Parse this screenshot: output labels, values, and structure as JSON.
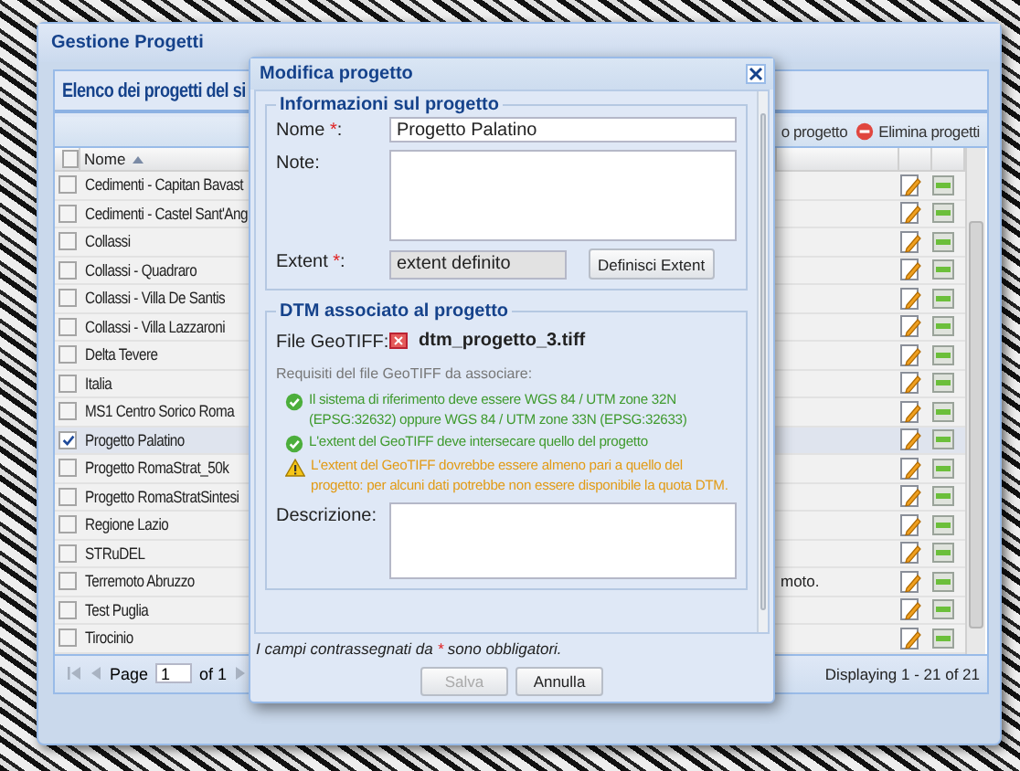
{
  "main_window": {
    "title": "Gestione Progetti",
    "panel_title": "Elenco dei progetti del si",
    "toolbar": [
      {
        "kind": "text",
        "label": "o progetto"
      },
      {
        "kind": "delete",
        "label": "Elimina progetti"
      }
    ],
    "grid": {
      "all_selected": false,
      "columns": [
        {
          "label": "Nome",
          "sort_ascending": true
        }
      ],
      "rows": [
        {
          "name": "Cedimenti - Capitan Bavast",
          "selected": false
        },
        {
          "name": "Cedimenti - Castel Sant'Ang",
          "selected": false
        },
        {
          "name": "Collassi",
          "selected": false
        },
        {
          "name": "Collassi - Quadraro",
          "selected": false
        },
        {
          "name": "Collassi - Villa De Santis",
          "selected": false
        },
        {
          "name": "Collassi - Villa Lazzaroni",
          "selected": false
        },
        {
          "name": "Delta Tevere",
          "selected": false
        },
        {
          "name": "Italia",
          "selected": false
        },
        {
          "name": "MS1 Centro Sorico Roma",
          "selected": false
        },
        {
          "name": "Progetto Palatino",
          "selected": true
        },
        {
          "name": "Progetto RomaStrat_50k",
          "selected": false
        },
        {
          "name": "Progetto RomaStratSintesi",
          "selected": false
        },
        {
          "name": "Regione Lazio",
          "selected": false
        },
        {
          "name": "STRuDEL",
          "selected": false
        },
        {
          "name": "Terremoto Abruzzo",
          "selected": false,
          "column_3": "moto."
        },
        {
          "name": "Test Puglia",
          "selected": false
        },
        {
          "name": "Tirocinio",
          "selected": false
        }
      ]
    },
    "paging": {
      "page_label": "Page",
      "page_value": "1",
      "of_label": "of 1",
      "display_info": "Displaying 1 - 21 of 21"
    }
  },
  "dialog": {
    "title": "Modifica progetto",
    "sections": [
      {
        "legend": "Informazioni sul progetto",
        "fields": [
          {
            "kind": "text",
            "label": "Nome",
            "mark": "*",
            "colon": ":",
            "value": "Progetto Palatino"
          },
          {
            "kind": "textarea",
            "label": "Note:"
          },
          {
            "kind": "readonly",
            "label": "Extent",
            "mark": "*",
            "colon": ":",
            "value": "extent definito",
            "button": "Definisci Extent"
          }
        ]
      },
      {
        "legend": "DTM associato al progetto",
        "fields": [
          {
            "kind": "file",
            "label": "File GeoTIFF:",
            "value": "dtm_progetto_3.tiff"
          },
          {
            "kind": "requirements",
            "label": "Requisiti del file GeoTIFF da associare:",
            "items": [
              {
                "kind": "ok",
                "text": "Il sistema di riferimento deve essere WGS 84 / UTM zone 32N (EPSG:32632) oppure WGS 84 / UTM zone 33N (EPSG:32633)"
              },
              {
                "kind": "ok",
                "text": "L'extent del GeoTIFF deve intersecare quello del progetto"
              },
              {
                "kind": "warning",
                "text": "L'extent del GeoTIFF dovrebbe essere almeno pari a quello del progetto: per alcuni dati potrebbe non essere disponibile la quota DTM."
              }
            ]
          },
          {
            "kind": "textarea",
            "label": "Descrizione:"
          }
        ]
      }
    ],
    "required_note": {
      "before": "I campi contrassegnati da",
      "mark": "*",
      "after": "sono obbligatori."
    },
    "buttons": [
      {
        "label": "Salva",
        "disabled": true
      },
      {
        "label": "Annulla",
        "disabled": false
      }
    ]
  }
}
